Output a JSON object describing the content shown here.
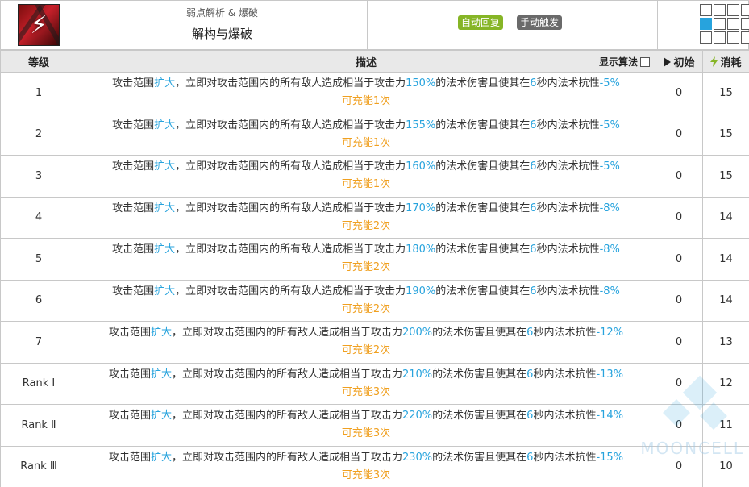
{
  "skill": {
    "icon": "burning-skill-icon",
    "subtitle": "弱点解析 & 爆破",
    "title": "解构与爆破",
    "tags": {
      "sp_recovery": "自动回复",
      "trigger": "手动触发"
    },
    "range_grid": [
      [
        0,
        0,
        0,
        0
      ],
      [
        1,
        0,
        0,
        0
      ],
      [
        0,
        0,
        0,
        0
      ]
    ]
  },
  "table": {
    "headers": {
      "level": "等级",
      "description": "描述",
      "show_algo": "显示算法",
      "initial": "初始",
      "cost": "消耗"
    },
    "rows": [
      {
        "level": "1",
        "desc_pre": "攻击范围",
        "expand": "扩大",
        "desc_mid": "，立即对攻击范围内的所有敌人造成相当于攻击力",
        "pct": "150%",
        "desc_mid2": "的法术伤害且使其在",
        "secs": "6",
        "desc_mid3": "秒内法术抗性",
        "res": "-5%",
        "charges": "可充能1次",
        "initial": "0",
        "cost": "15"
      },
      {
        "level": "2",
        "desc_pre": "攻击范围",
        "expand": "扩大",
        "desc_mid": "，立即对攻击范围内的所有敌人造成相当于攻击力",
        "pct": "155%",
        "desc_mid2": "的法术伤害且使其在",
        "secs": "6",
        "desc_mid3": "秒内法术抗性",
        "res": "-5%",
        "charges": "可充能1次",
        "initial": "0",
        "cost": "15"
      },
      {
        "level": "3",
        "desc_pre": "攻击范围",
        "expand": "扩大",
        "desc_mid": "，立即对攻击范围内的所有敌人造成相当于攻击力",
        "pct": "160%",
        "desc_mid2": "的法术伤害且使其在",
        "secs": "6",
        "desc_mid3": "秒内法术抗性",
        "res": "-5%",
        "charges": "可充能1次",
        "initial": "0",
        "cost": "15"
      },
      {
        "level": "4",
        "desc_pre": "攻击范围",
        "expand": "扩大",
        "desc_mid": "，立即对攻击范围内的所有敌人造成相当于攻击力",
        "pct": "170%",
        "desc_mid2": "的法术伤害且使其在",
        "secs": "6",
        "desc_mid3": "秒内法术抗性",
        "res": "-8%",
        "charges": "可充能2次",
        "initial": "0",
        "cost": "14"
      },
      {
        "level": "5",
        "desc_pre": "攻击范围",
        "expand": "扩大",
        "desc_mid": "，立即对攻击范围内的所有敌人造成相当于攻击力",
        "pct": "180%",
        "desc_mid2": "的法术伤害且使其在",
        "secs": "6",
        "desc_mid3": "秒内法术抗性",
        "res": "-8%",
        "charges": "可充能2次",
        "initial": "0",
        "cost": "14"
      },
      {
        "level": "6",
        "desc_pre": "攻击范围",
        "expand": "扩大",
        "desc_mid": "，立即对攻击范围内的所有敌人造成相当于攻击力",
        "pct": "190%",
        "desc_mid2": "的法术伤害且使其在",
        "secs": "6",
        "desc_mid3": "秒内法术抗性",
        "res": "-8%",
        "charges": "可充能2次",
        "initial": "0",
        "cost": "14"
      },
      {
        "level": "7",
        "desc_pre": "攻击范围",
        "expand": "扩大",
        "desc_mid": "，立即对攻击范围内的所有敌人造成相当于攻击力",
        "pct": "200%",
        "desc_mid2": "的法术伤害且使其在",
        "secs": "6",
        "desc_mid3": "秒内法术抗性",
        "res": "-12%",
        "charges": "可充能2次",
        "initial": "0",
        "cost": "13"
      },
      {
        "level": "Rank Ⅰ",
        "desc_pre": "攻击范围",
        "expand": "扩大",
        "desc_mid": "，立即对攻击范围内的所有敌人造成相当于攻击力",
        "pct": "210%",
        "desc_mid2": "的法术伤害且使其在",
        "secs": "6",
        "desc_mid3": "秒内法术抗性",
        "res": "-13%",
        "charges": "可充能3次",
        "initial": "0",
        "cost": "12"
      },
      {
        "level": "Rank Ⅱ",
        "desc_pre": "攻击范围",
        "expand": "扩大",
        "desc_mid": "，立即对攻击范围内的所有敌人造成相当于攻击力",
        "pct": "220%",
        "desc_mid2": "的法术伤害且使其在",
        "secs": "6",
        "desc_mid3": "秒内法术抗性",
        "res": "-14%",
        "charges": "可充能3次",
        "initial": "0",
        "cost": "11"
      },
      {
        "level": "Rank Ⅲ",
        "desc_pre": "攻击范围",
        "expand": "扩大",
        "desc_mid": "，立即对攻击范围内的所有敌人造成相当于攻击力",
        "pct": "230%",
        "desc_mid2": "的法术伤害且使其在",
        "secs": "6",
        "desc_mid3": "秒内法术抗性",
        "res": "-15%",
        "charges": "可充能3次",
        "initial": "0",
        "cost": "10"
      }
    ]
  },
  "watermark": "MOONCELL",
  "colors": {
    "accent": "#27a3dd",
    "charges": "#f0a020",
    "auto_tag": "#86b526",
    "manual_tag": "#6a6a6a",
    "header_bg": "#e9e9e9",
    "bolt": "#86b526"
  }
}
